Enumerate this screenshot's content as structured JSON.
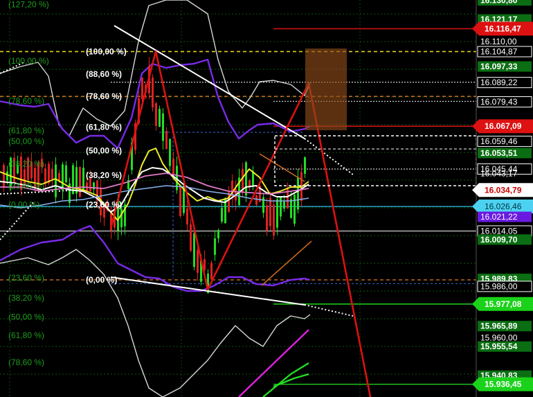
{
  "chart_data": {
    "type": "candlestick",
    "y_axis": {
      "range": [
        15.93,
        16.131
      ],
      "position": "right"
    },
    "price_labels": [
      {
        "text": "16.130,80",
        "value": 16.1308,
        "style": "green"
      },
      {
        "text": "16.121,17",
        "value": 16.12117,
        "style": "green"
      },
      {
        "text": "16.116,47",
        "value": 16.11647,
        "style": "red-tag"
      },
      {
        "text": "16.110,00",
        "value": 16.11,
        "style": "plain"
      },
      {
        "text": "16.104,87",
        "value": 16.10487,
        "style": "white-box"
      },
      {
        "text": "16.097,33",
        "value": 16.09733,
        "style": "green"
      },
      {
        "text": "16.089,22",
        "value": 16.08922,
        "style": "white-box"
      },
      {
        "text": "16.079,43",
        "value": 16.07943,
        "style": "white-box"
      },
      {
        "text": "16.067,09",
        "value": 16.06709,
        "style": "red-tag"
      },
      {
        "text": "16.059,46",
        "value": 16.05946,
        "style": "white-box"
      },
      {
        "text": "16.053,51",
        "value": 16.05351,
        "style": "green"
      },
      {
        "text": "16.045,44",
        "value": 16.04544,
        "style": "white-box"
      },
      {
        "text": "16.043,17",
        "value": 16.04317,
        "style": "plain"
      },
      {
        "text": "16.034,79",
        "value": 16.03479,
        "style": "white-tag"
      },
      {
        "text": "16.026,46",
        "value": 16.02646,
        "style": "cyan-tag"
      },
      {
        "text": "16.021,22",
        "value": 16.02122,
        "style": "purple"
      },
      {
        "text": "16.014,05",
        "value": 16.01405,
        "style": "white-box"
      },
      {
        "text": "16.009,70",
        "value": 16.0097,
        "style": "green"
      },
      {
        "text": "15.989,83",
        "value": 15.98983,
        "style": "green"
      },
      {
        "text": "15.986,00",
        "value": 15.986,
        "style": "white-box"
      },
      {
        "text": "15.977,08",
        "value": 15.97708,
        "style": "green-tag"
      },
      {
        "text": "15.965,89",
        "value": 15.96589,
        "style": "green"
      },
      {
        "text": "15.960,00",
        "value": 15.96,
        "style": "plain"
      },
      {
        "text": "15.955,54",
        "value": 15.95554,
        "style": "green"
      },
      {
        "text": "15.940,83",
        "value": 15.94083,
        "style": "green"
      },
      {
        "text": "15.936,45",
        "value": 15.93645,
        "style": "green-tag"
      }
    ],
    "fib_right": [
      {
        "label": "(100,00 %)",
        "value": 16.1049
      },
      {
        "label": "(88,60 %)",
        "value": 16.0934
      },
      {
        "label": "(78,60 %)",
        "value": 16.0822
      },
      {
        "label": "(61,80 %)",
        "value": 16.0667
      },
      {
        "label": "(50,00 %)",
        "value": 16.0547
      },
      {
        "label": "(38,20 %)",
        "value": 16.0423
      },
      {
        "label": "(23,60 %)",
        "value": 16.0274
      },
      {
        "label": "(0,00 %)",
        "value": 15.9893
      }
    ],
    "fib_left": [
      {
        "label": "(127,20 %)",
        "value": 16.1288
      },
      {
        "label": "(100,00 %)",
        "value": 16.1001
      },
      {
        "label": "(78,60 %)",
        "value": 16.0798
      },
      {
        "label": "(61,80 %)",
        "value": 16.0649
      },
      {
        "label": "(50,00 %)",
        "value": 16.0594
      },
      {
        "label": "(38,20 %)",
        "value": 16.0481
      },
      {
        "label": "(23,60 %)",
        "value": 16.0368
      },
      {
        "label": "(0,00 %)",
        "value": 16.0274
      },
      {
        "label": "(23,60 %)",
        "value": 15.9903
      },
      {
        "label": "(38,20 %)",
        "value": 15.9801
      },
      {
        "label": "(50,00 %)",
        "value": 15.9705
      },
      {
        "label": "(61,80 %)",
        "value": 15.9612
      },
      {
        "label": "(78,60 %)",
        "value": 15.9475
      }
    ]
  }
}
